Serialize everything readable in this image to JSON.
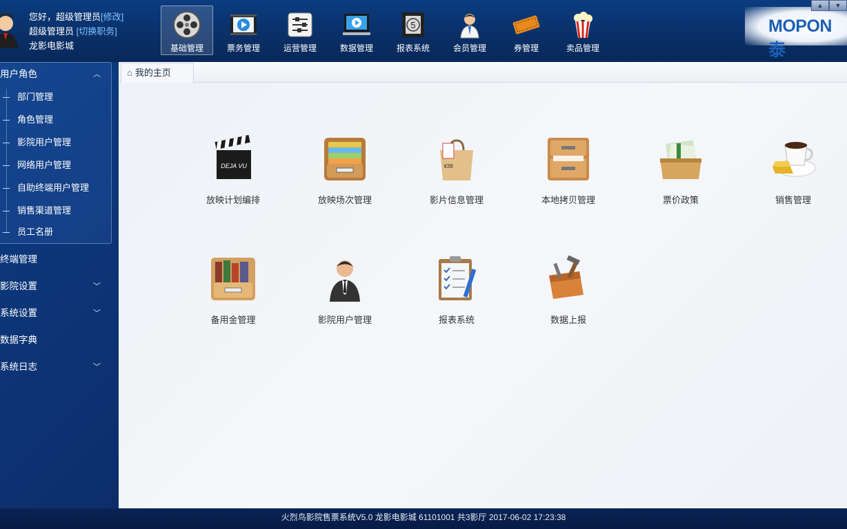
{
  "user": {
    "greeting": "您好，超级管理员",
    "edit_link": "[修改]",
    "role": "超级管理员",
    "switch_link": "[切换职务]",
    "cinema": "龙影电影城"
  },
  "nav": {
    "items": [
      {
        "label": "基础管理",
        "icon": "film-reel-icon",
        "active": true
      },
      {
        "label": "票务管理",
        "icon": "film-play-icon"
      },
      {
        "label": "运营管理",
        "icon": "sliders-icon"
      },
      {
        "label": "数据管理",
        "icon": "monitor-play-icon"
      },
      {
        "label": "报表系统",
        "icon": "film-countdown-icon"
      },
      {
        "label": "会员管理",
        "icon": "member-person-icon"
      },
      {
        "label": "券管理",
        "icon": "ticket-icon"
      },
      {
        "label": "卖品管理",
        "icon": "popcorn-icon"
      }
    ]
  },
  "brand": {
    "text": "MOPON泰"
  },
  "sidebar": {
    "group": {
      "label": "用户角色",
      "expanded": true
    },
    "subitems": [
      {
        "label": "部门管理"
      },
      {
        "label": "角色管理"
      },
      {
        "label": "影院用户管理"
      },
      {
        "label": "网络用户管理"
      },
      {
        "label": "自助终端用户管理"
      },
      {
        "label": "销售渠道管理"
      },
      {
        "label": "员工名册"
      }
    ],
    "items": [
      {
        "label": "终端管理",
        "chevron": false
      },
      {
        "label": "影院设置",
        "chevron": true
      },
      {
        "label": "系统设置",
        "chevron": true
      },
      {
        "label": "数据字典",
        "chevron": false
      },
      {
        "label": "系统日志",
        "chevron": true
      }
    ]
  },
  "tab": {
    "label": "我的主页",
    "icon": "home-icon"
  },
  "apps": [
    {
      "label": "放映计划编排",
      "icon": "clapperboard-icon",
      "clapper_text": "DEJA VU"
    },
    {
      "label": "放映场次管理",
      "icon": "file-drawer-icon"
    },
    {
      "label": "影片信息管理",
      "icon": "shopping-bag-icon",
      "price_text": "¥38"
    },
    {
      "label": "本地拷贝管理",
      "icon": "cabinet-icon"
    },
    {
      "label": "票价政策",
      "icon": "money-tray-icon"
    },
    {
      "label": "销售管理",
      "icon": "coffee-gold-icon"
    },
    {
      "label": "备用金管理",
      "icon": "book-box-icon"
    },
    {
      "label": "影院用户管理",
      "icon": "business-person-icon"
    },
    {
      "label": "报表系统",
      "icon": "clipboard-icon"
    },
    {
      "label": "数据上报",
      "icon": "toolbox-icon"
    }
  ],
  "status_bar": {
    "text": "火烈鸟影院售票系统V5.0 龙影电影城 61101001 共3影厅 2017-06-02 17:23:38"
  },
  "colors": {
    "header_bg": "#0a2f66",
    "link": "#7fc3ff",
    "main_bg": "#f3f5f9",
    "brand": "#1c5fb4"
  }
}
